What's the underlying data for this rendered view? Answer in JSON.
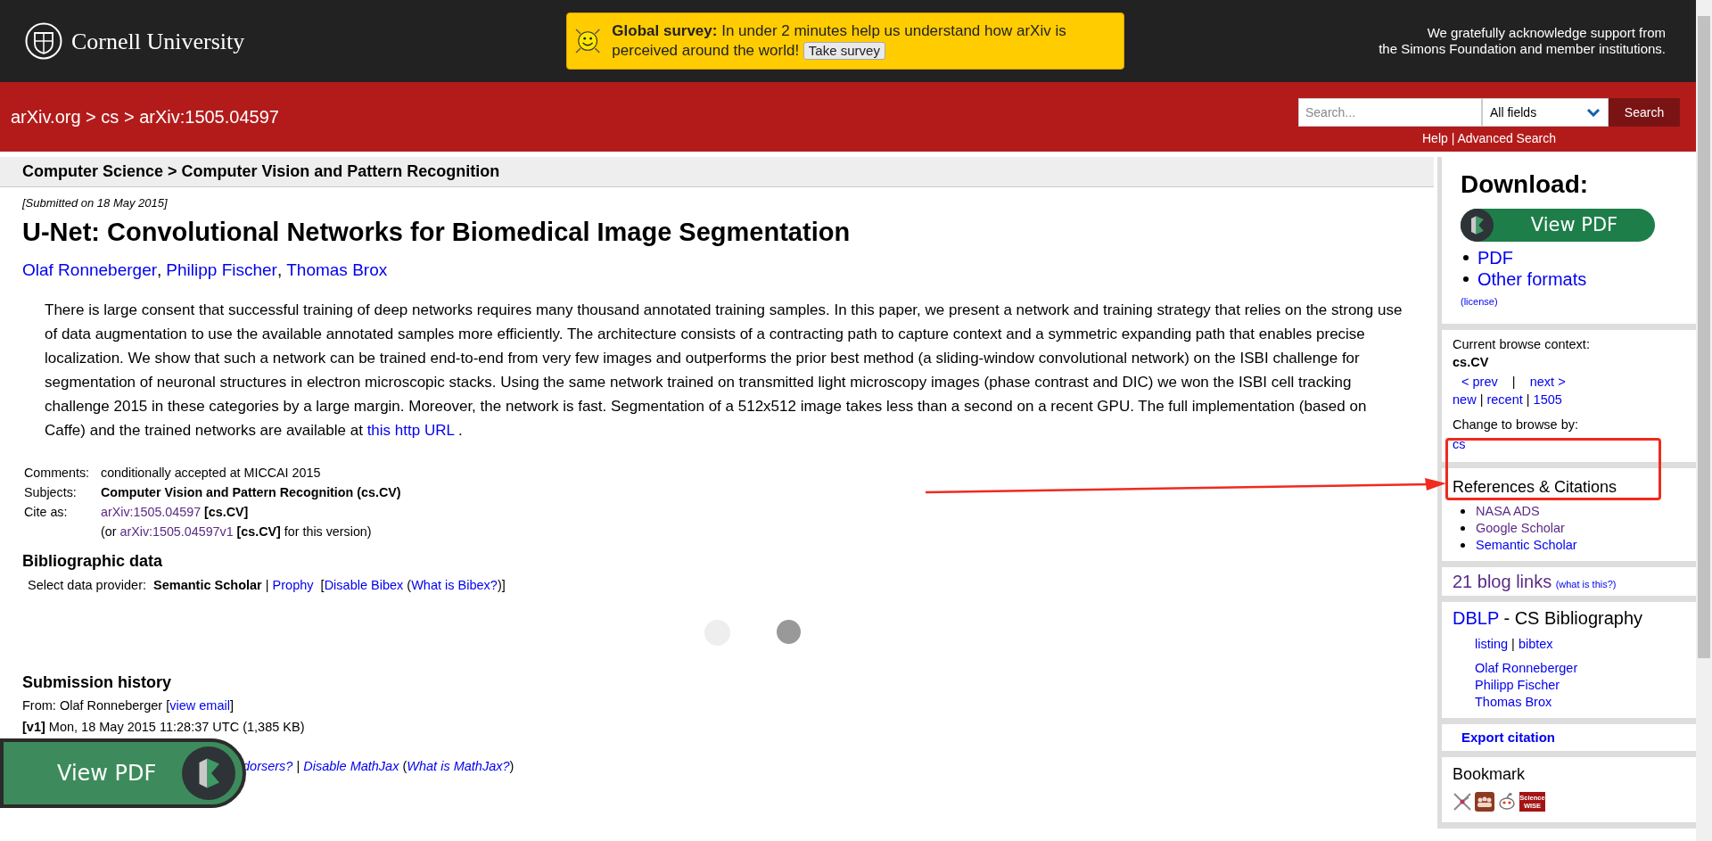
{
  "header": {
    "logo_text": "Cornell University",
    "survey": {
      "lead": "Global survey:",
      "text": "In under 2 minutes help us understand how arXiv is perceived around the world!",
      "button": "Take survey"
    },
    "support": [
      "We gratefully acknowledge support from",
      "the Simons Foundation and member institutions."
    ]
  },
  "navbar": {
    "breadcrumb": "arXiv.org > cs > arXiv:1505.04597",
    "search": {
      "placeholder": "Search...",
      "field": "All fields",
      "button": "Search"
    },
    "links": [
      "Help",
      "Advanced Search"
    ],
    "link_separator": " | "
  },
  "main": {
    "breadcrumb": "Computer Science > Computer Vision and Pattern Recognition",
    "submitted": "[Submitted on 18 May 2015]",
    "title": "U-Net: Convolutional Networks for Biomedical Image Segmentation",
    "authors": [
      {
        "name": "Olaf Ronneberger",
        "trail": ","
      },
      {
        "name": "Philipp Fischer",
        "trail": ","
      },
      {
        "name": "Thomas Brox"
      }
    ],
    "abstract": [
      {
        "kind": "text",
        "t": "There is large consent that successful training of deep networks requires many thousand annotated training samples. In this paper, we present a network and training strategy that relies on the strong use of data augmentation to use the available annotated samples more efficiently. The architecture consists of a contracting path to capture context and a symmetric expanding path that enables precise localization. We show that such a network can be trained end-to-end from very few images and outperforms the prior best method (a sliding-window convolutional network) on the ISBI challenge for segmentation of neuronal structures in electron microscopic stacks. Using the same network trained on transmitted light microscopy images (phase contrast and DIC) we won the ISBI cell tracking challenge 2015 in these categories by a large margin. Moreover, the network is fast. Segmentation of a 512x512 image takes less than a second on a recent GPU. The full implementation (based on Caffe) and the trained networks are available at "
      },
      {
        "kind": "link",
        "t": "this http URL"
      },
      {
        "kind": "text",
        "t": " ."
      }
    ],
    "metadata": [
      {
        "label": "Comments:",
        "value": [
          {
            "kind": "text",
            "t": "conditionally accepted at MICCAI 2015"
          }
        ]
      },
      {
        "label": "Subjects:",
        "value": [
          {
            "kind": "bold",
            "t": "Computer Vision and Pattern Recognition (cs.CV)"
          }
        ]
      },
      {
        "label": "Cite as:",
        "value": [
          {
            "kind": "visited",
            "t": "arXiv:1505.04597"
          },
          {
            "kind": "bold",
            "t": " [cs.CV]"
          }
        ]
      },
      {
        "value": [
          {
            "kind": "text",
            "t": "(or "
          },
          {
            "kind": "visited",
            "t": "arXiv:1505.04597v1"
          },
          {
            "kind": "bold",
            "t": " [cs.CV]"
          },
          {
            "kind": "text",
            "t": " for this version)"
          }
        ]
      }
    ],
    "bib_heading": "Bibliographic data",
    "bib_provider": [
      {
        "kind": "text",
        "t": "Select data provider:  "
      },
      {
        "kind": "bold",
        "t": "Semantic Scholar"
      },
      {
        "kind": "text",
        "t": " | "
      },
      {
        "kind": "link",
        "t": "Prophy"
      },
      {
        "kind": "text",
        "t": "  ["
      },
      {
        "kind": "link",
        "t": "Disable Bibex"
      },
      {
        "kind": "text",
        "t": " ("
      },
      {
        "kind": "link",
        "t": "What is Bibex?"
      },
      {
        "kind": "text",
        "t": ")]"
      }
    ],
    "history_heading": "Submission history",
    "history": [
      [
        {
          "kind": "text",
          "t": "From: Olaf Ronneberger ["
        },
        {
          "kind": "link",
          "t": "view email"
        },
        {
          "kind": "text",
          "t": "]"
        }
      ],
      [
        {
          "kind": "bold",
          "t": "[v1]"
        },
        {
          "kind": "text",
          "t": " Mon, 18 May 2015 11:28:37 UTC (1,385 KB)"
        }
      ]
    ],
    "mathjax": [
      {
        "kind": "italic-link",
        "t": "dorsers?"
      },
      {
        "kind": "text",
        "t": " | "
      },
      {
        "kind": "italic-link",
        "t": "Disable MathJax"
      },
      {
        "kind": "text",
        "t": " ("
      },
      {
        "kind": "italic-link",
        "t": "What is MathJax?"
      },
      {
        "kind": "text",
        "t": ")"
      }
    ],
    "floating_button": "View PDF"
  },
  "sidebar": {
    "download": {
      "heading": "Download:",
      "button": "View PDF",
      "formats": [
        "PDF",
        "Other formats"
      ],
      "license": "(license)"
    },
    "browse": {
      "label": "Current browse context:",
      "context": "cs.CV",
      "nav": [
        {
          "kind": "link",
          "t": "< prev"
        },
        {
          "kind": "text",
          "t": "    |    "
        },
        {
          "kind": "link",
          "t": "next >"
        }
      ],
      "lists": [
        {
          "kind": "link",
          "t": "new"
        },
        {
          "kind": "text",
          "t": " | "
        },
        {
          "kind": "link",
          "t": "recent"
        },
        {
          "kind": "text",
          "t": " | "
        },
        {
          "kind": "link",
          "t": "1505"
        }
      ],
      "change_label": "Change to browse by:",
      "change_link": "cs"
    },
    "references": {
      "heading": "References & Citations",
      "items": [
        {
          "label": "NASA ADS",
          "visited": true
        },
        {
          "label": "Google Scholar",
          "visited": true
        },
        {
          "label": "Semantic Scholar",
          "visited": false
        }
      ]
    },
    "blog": {
      "count": "21 blog links",
      "help": "(what is this?)"
    },
    "dblp": {
      "title": [
        {
          "kind": "link",
          "t": "DBLP"
        },
        {
          "kind": "text",
          "t": " - CS Bibliography"
        }
      ],
      "links": [
        {
          "kind": "link",
          "t": "listing"
        },
        {
          "kind": "text",
          "t": " | "
        },
        {
          "kind": "link",
          "t": "bibtex"
        }
      ],
      "authors": [
        "Olaf Ronneberger",
        "Philipp Fischer",
        "Thomas Brox"
      ]
    },
    "export": "Export citation",
    "bookmark": {
      "heading": "Bookmark",
      "icons": [
        {
          "kind": "network"
        },
        {
          "kind": "people"
        },
        {
          "kind": "robot"
        },
        {
          "kind": "badge",
          "lines": [
            "Science",
            "WISE"
          ]
        }
      ]
    }
  }
}
